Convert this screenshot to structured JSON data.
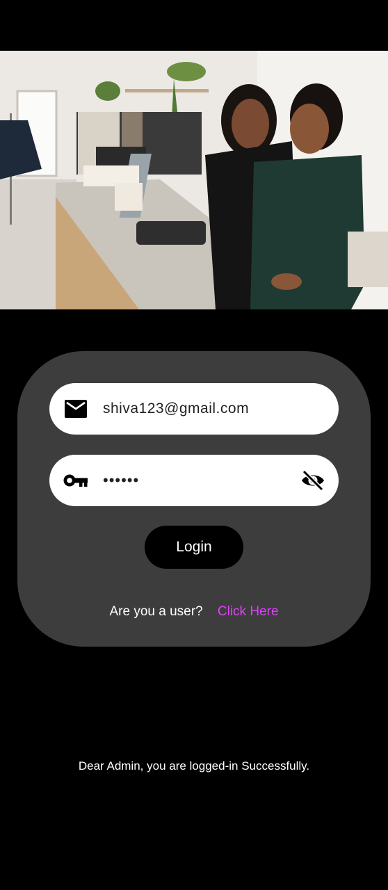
{
  "login_form": {
    "email_value": "shiva123@gmail.com",
    "password_value": "••••••",
    "login_label": "Login",
    "user_prompt": "Are you a user?",
    "user_link": "Click Here"
  },
  "status_message": "Dear Admin, you are logged-in Successfully.",
  "icons": {
    "email": "mail-icon",
    "password": "key-icon",
    "visibility": "eye-off-icon"
  },
  "colors": {
    "background": "#000000",
    "card": "#3d3d3d",
    "link": "#e040fb"
  }
}
